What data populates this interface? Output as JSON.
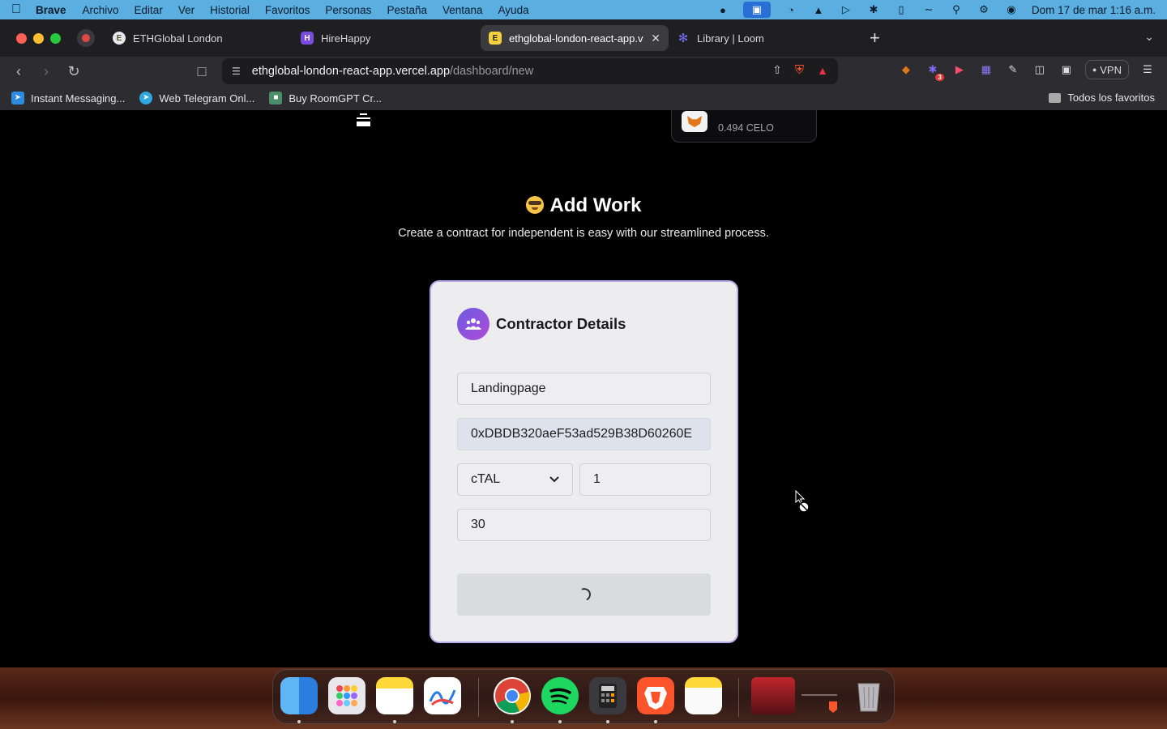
{
  "menubar": {
    "app": "Brave",
    "items": [
      "Archivo",
      "Editar",
      "Ver",
      "Historial",
      "Favoritos",
      "Personas",
      "Pestaña",
      "Ventana",
      "Ayuda"
    ],
    "clock": "Dom 17 de mar  1:16 a.m."
  },
  "tabs": [
    {
      "label": "ETHGlobal London",
      "active": false
    },
    {
      "label": "HireHappy",
      "active": false
    },
    {
      "label": "ethglobal-london-react-app.v",
      "active": true
    },
    {
      "label": "Library | Loom",
      "active": false
    }
  ],
  "url": {
    "host": "ethglobal-london-react-app.vercel.app",
    "path": "/dashboard/new"
  },
  "extensions": {
    "vpn_label": "VPN",
    "badge_count": "3"
  },
  "bookmarks": [
    "Instant Messaging...",
    "Web Telegram Onl...",
    "Buy RoomGPT Cr..."
  ],
  "bookmarks_all": "Todos los favoritos",
  "wallet": {
    "balance": "0.494 CELO"
  },
  "page": {
    "title": "Add Work",
    "subtitle": "Create a contract for independent is easy with our streamlined process."
  },
  "card": {
    "title": "Contractor Details",
    "name_value": "Landingpage",
    "address_value": "0xDBDB320aeF53ad529B38D60260E",
    "token_selected": "cTAL",
    "amount_value": "1",
    "days_value": "30"
  },
  "colors": {
    "accent": "#b9a8e8",
    "menubar": "#5aaee0",
    "card_bg": "#ededf0"
  }
}
